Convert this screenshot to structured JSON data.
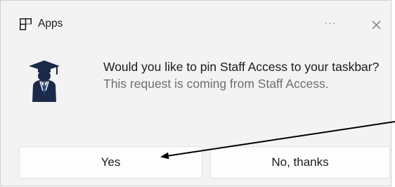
{
  "header": {
    "app_title": "Apps",
    "app_icon": "apps-grid-icon",
    "more_label": "···",
    "more_icon": "more-options-icon",
    "close_icon": "close-icon"
  },
  "message": {
    "icon": "staff-access-app-icon",
    "title": "Would you like to pin Staff Access to your taskbar?",
    "subtitle": "This request is coming from Staff Access."
  },
  "buttons": {
    "yes_label": "Yes",
    "no_label": "No, thanks"
  },
  "annotation": {
    "icon": "arrow-pointing-to-yes-icon",
    "color": "#000000"
  },
  "colors": {
    "dialog_background": "#f3f3f3",
    "button_background": "#fdfdfd",
    "icon_navy": "#1c2a4a"
  }
}
